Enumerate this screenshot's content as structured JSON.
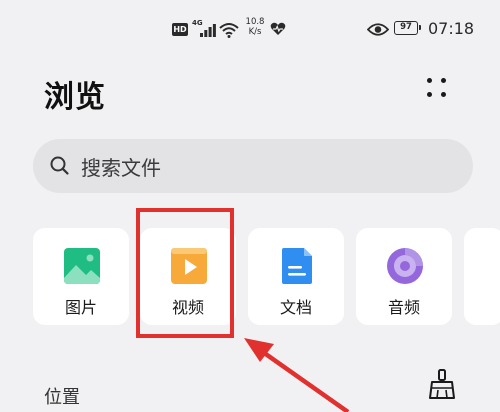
{
  "status_bar": {
    "hd": "HD",
    "network_type": "4G",
    "speed_value": "10.8",
    "speed_unit": "K/s",
    "battery_level": "97",
    "time": "07:18"
  },
  "header": {
    "title": "浏览"
  },
  "search": {
    "placeholder": "搜索文件"
  },
  "categories": [
    {
      "label": "图片",
      "icon": "image-icon",
      "color": "#1fbd84"
    },
    {
      "label": "视频",
      "icon": "video-icon",
      "color": "#f7a93a"
    },
    {
      "label": "文档",
      "icon": "document-icon",
      "color": "#2f8ef0"
    },
    {
      "label": "音频",
      "icon": "audio-icon",
      "color": "#9467dc"
    }
  ],
  "location_section": {
    "title": "位置"
  },
  "annotation": {
    "color": "#e0312f"
  }
}
